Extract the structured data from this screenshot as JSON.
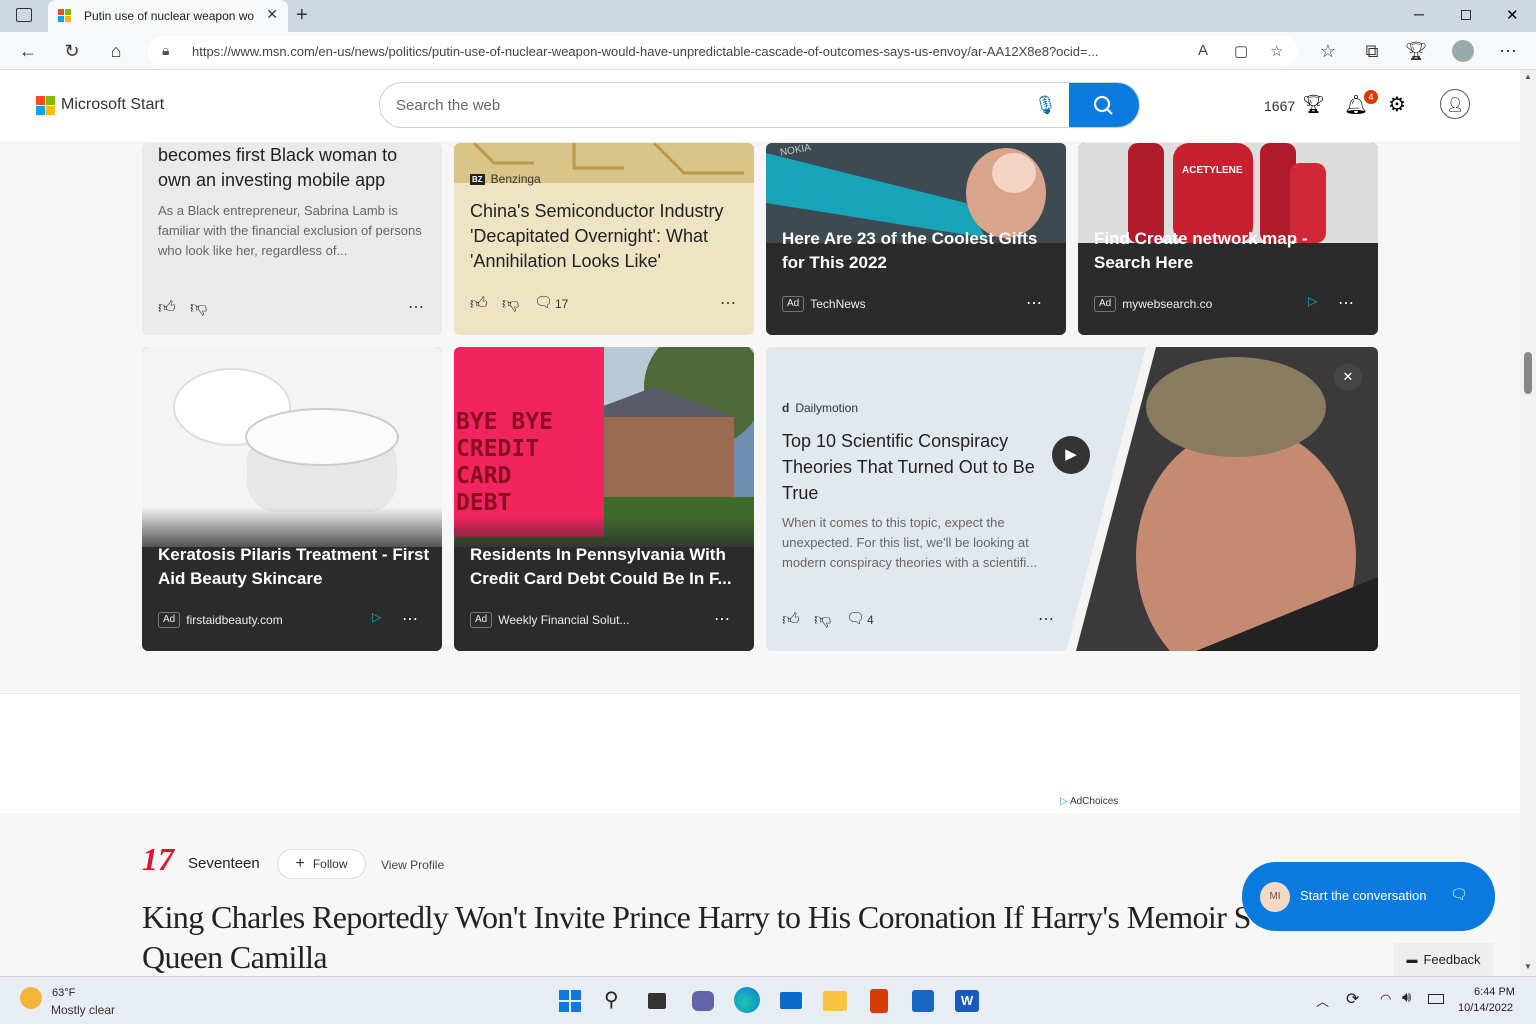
{
  "browser": {
    "tab_title": "Putin use of nuclear weapon wou",
    "url": "https://www.msn.com/en-us/news/politics/putin-use-of-nuclear-weapon-would-have-unpredictable-cascade-of-outcomes-says-us-envoy/ar-AA12X8e8?ocid=..."
  },
  "header": {
    "brand": "Microsoft Start",
    "search_placeholder": "Search the web",
    "points": "1667",
    "notification_count": "4"
  },
  "cards_row1": [
    {
      "headline": "becomes first Black woman to own an investing mobile app",
      "summary": "As a Black entrepreneur, Sabrina Lamb is familiar with the financial exclusion of persons who look like her, regardless of..."
    },
    {
      "source": "Benzinga",
      "source_abbr": "BZ",
      "headline": "China's Semiconductor Industry 'Decapitated Overnight': What 'Annihilation Looks Like'",
      "comments": "17"
    },
    {
      "headline": "Here Are 23 of the Coolest Gifts for This 2022",
      "ad": "Ad",
      "source": "TechNews",
      "image_text": "NOKIA"
    },
    {
      "headline": "Find Create network map - Search Here",
      "ad": "Ad",
      "source": "mywebsearch.co",
      "image_text": "ACETYLENE"
    }
  ],
  "cards_row2": [
    {
      "headline": "Keratosis Pilaris Treatment - First Aid Beauty Skincare",
      "ad": "Ad",
      "source": "firstaidbeauty.com"
    },
    {
      "headline": "Residents In Pennsylvania With Credit Card Debt Could Be In F...",
      "ad": "Ad",
      "source": "Weekly Financial Solut...",
      "sign_lines": [
        "BYE BYE",
        "CREDIT",
        "CARD",
        "DEBT"
      ]
    },
    {
      "source": "Dailymotion",
      "source_abbr": "d",
      "headline": "Top 10 Scientific Conspiracy Theories That Turned Out to Be True",
      "summary": "When it comes to this topic, expect the unexpected. For this list, we'll be looking at modern conspiracy theories with a scientifi...",
      "comments": "4"
    }
  ],
  "adchoices": "AdChoices",
  "publisher": {
    "logo": "17",
    "name": "Seventeen",
    "follow": "Follow",
    "view_profile": "View Profile"
  },
  "article_title": "King Charles Reportedly Won't Invite Prince Harry to His Coronation If Harry's Memoir S... Queen Camilla",
  "article_title_line1": "King Charles Reportedly Won't Invite Prince Harry to His Coronation If Harry's Memoir S",
  "article_title_line2": "Queen Camilla",
  "conversation": {
    "initials": "MI",
    "label": "Start the conversation"
  },
  "feedback": "Feedback",
  "taskbar": {
    "temp": "63°F",
    "weather": "Mostly clear",
    "time": "6:44 PM",
    "date": "10/14/2022"
  },
  "colors": {
    "accent": "#0a7ae0",
    "card_dark": "#2b2b2b",
    "seventeen_red": "#e2132e",
    "sign_pink": "#f0245e"
  }
}
